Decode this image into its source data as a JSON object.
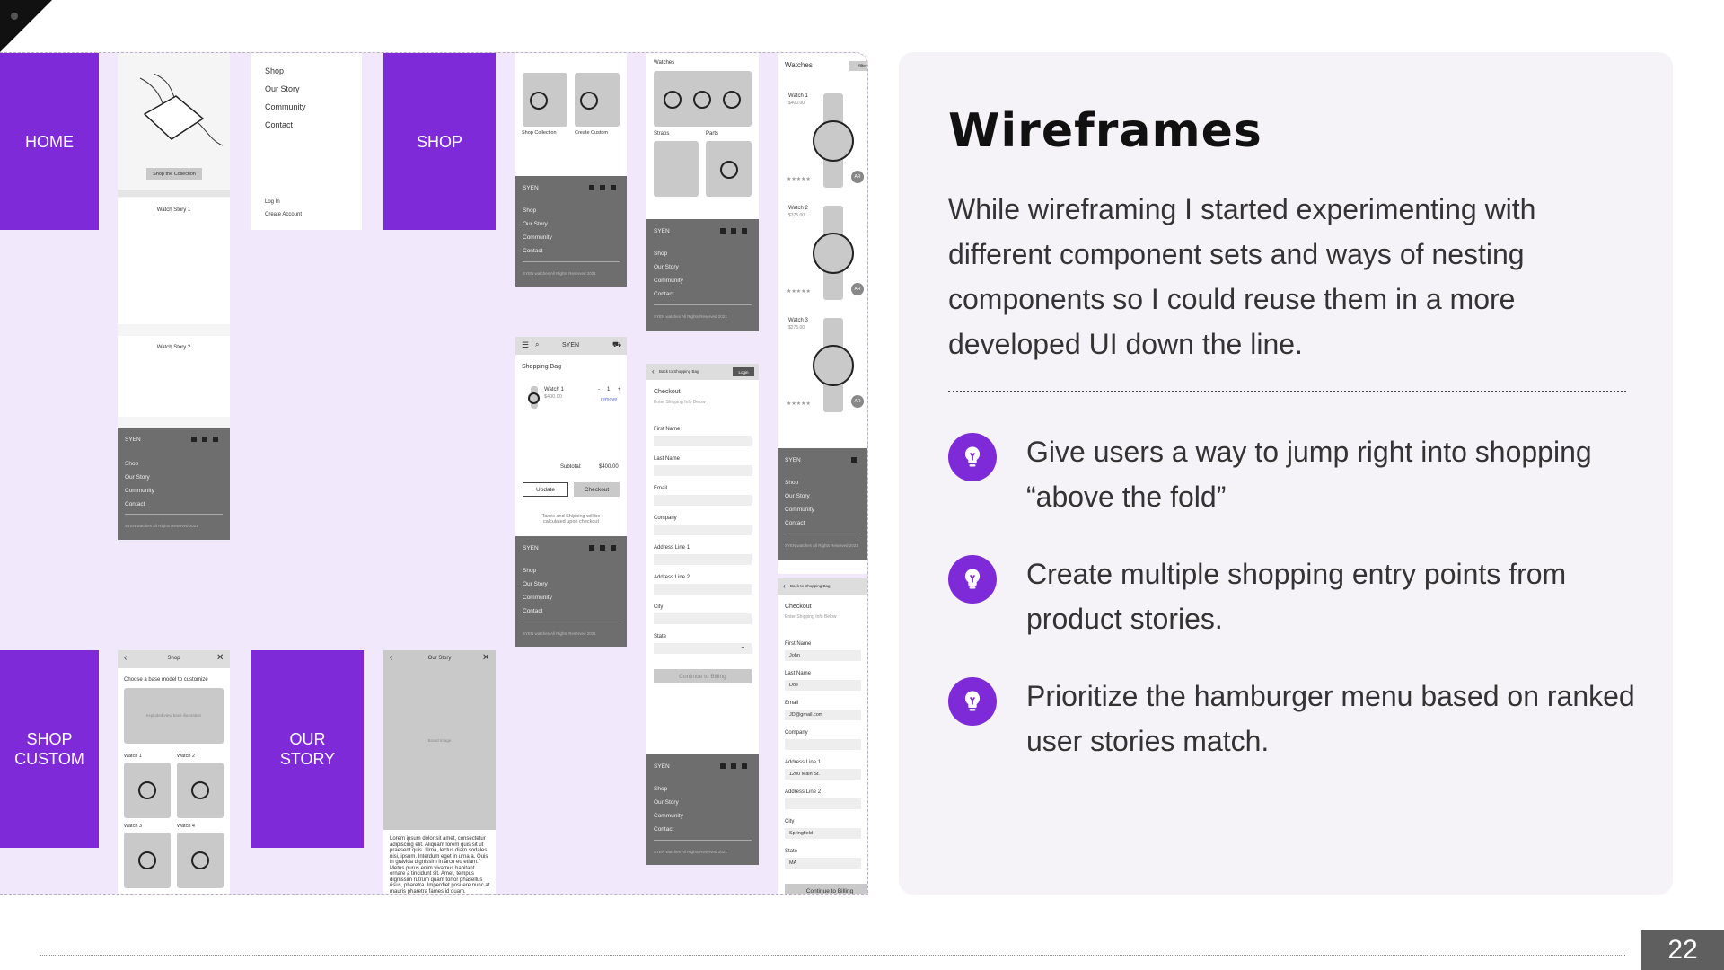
{
  "slide": {
    "title": "Wireframes",
    "intro": "While wireframing I started experimenting with different component sets and ways of nesting components so I could reuse them in a more developed UI down the line.",
    "bullets": [
      "Give users a way to jump right into shopping “above the fold”",
      "Create multiple shopping entry points from product stories.",
      "Prioritize the hamburger menu based on ranked user stories match."
    ],
    "page_number": "22",
    "accent_color": "#7e2ad9",
    "bullet_icon": "lightbulb-icon"
  },
  "wireframes": {
    "labels": {
      "home": "HOME",
      "shop": "SHOP",
      "shop_custom": "SHOP CUSTOM",
      "our_story": "OUR STORY"
    },
    "home": {
      "cta": "Shop the Collection",
      "story1": "Watch Story 1",
      "story2": "Watch Story 2"
    },
    "menu": {
      "items": [
        "Shop",
        "Our Story",
        "Community",
        "Contact"
      ],
      "login": "Log In",
      "create_account": "Create Account"
    },
    "footer": {
      "brand": "SYEN",
      "links": [
        "Shop",
        "Our Story",
        "Community",
        "Contact"
      ],
      "copyright": "SYEN watches All Rights Reserved 2021"
    },
    "shop_landing": {
      "shop_collection": "Shop Collection",
      "create_custom": "Create Custom"
    },
    "watches_grid": {
      "title": "Watches",
      "straps": "Straps",
      "parts": "Parts"
    },
    "bag": {
      "brand": "SYEN",
      "title": "Shopping Bag",
      "item": "Watch 1",
      "price": "$400.00",
      "qty_minus": "-",
      "qty": "1",
      "qty_plus": "+",
      "remove": "remove",
      "subtotal_label": "Subtotal:",
      "subtotal": "$400.00",
      "update": "Update",
      "checkout": "Checkout",
      "note": "Taxes and Shipping will be calculated upon checkout"
    },
    "checkout": {
      "back": "Back to Shopping Bag",
      "login": "Login",
      "title": "Checkout",
      "subtitle": "Enter Shipping Info Below",
      "fields": [
        "First Name",
        "Last Name",
        "Email",
        "Company",
        "Address Line 1",
        "Address Line 2",
        "City",
        "State"
      ],
      "continue": "Continue to Billing"
    },
    "watch_list": {
      "title": "Watches",
      "filter": "filter",
      "items": [
        {
          "name": "Watch 1",
          "price": "$400.00"
        },
        {
          "name": "Watch 2",
          "price": "$375.00"
        },
        {
          "name": "Watch 3",
          "price": "$275.00"
        }
      ],
      "ar": "AR"
    },
    "checkout_filled": {
      "back": "Back to Shopping Bag",
      "title": "Checkout",
      "subtitle": "Enter Shipping Info Below",
      "fields": [
        {
          "label": "First Name",
          "value": "John"
        },
        {
          "label": "Last Name",
          "value": "Doe"
        },
        {
          "label": "Email",
          "value": "JD@gmail.com"
        },
        {
          "label": "Company",
          "value": ""
        },
        {
          "label": "Address Line 1",
          "value": "1200 Main St."
        },
        {
          "label": "Address Line 2",
          "value": ""
        },
        {
          "label": "City",
          "value": "Springfield"
        },
        {
          "label": "State",
          "value": "MA"
        }
      ],
      "continue": "Continue to Billing"
    },
    "custom_shop": {
      "header": "Shop",
      "prompt": "Choose a base model to customize",
      "illustration": "exploded view base illustration",
      "watches": [
        "Watch 1",
        "Watch 2",
        "Watch 3",
        "Watch 4"
      ]
    },
    "our_story": {
      "header": "Our Story",
      "image": "Brand Image",
      "body": "Lorem ipsum dolor sit amet, consectetur adipiscing elit. Aliquam lorem quis sit ut praesent quis. Urna, lectus diam sodales nisi, ipsum. Interdum eget in urna a. Quis in gravida dignissim in arcu eu etiam. Metus purus enim vivamus habitant ornare a tincidunt sit. Amet, tempus dignissim rutrum quam tortor phasellus risus, pharetra. Imperdiet posuere nunc at mauris pharetra fames id quam."
    }
  }
}
